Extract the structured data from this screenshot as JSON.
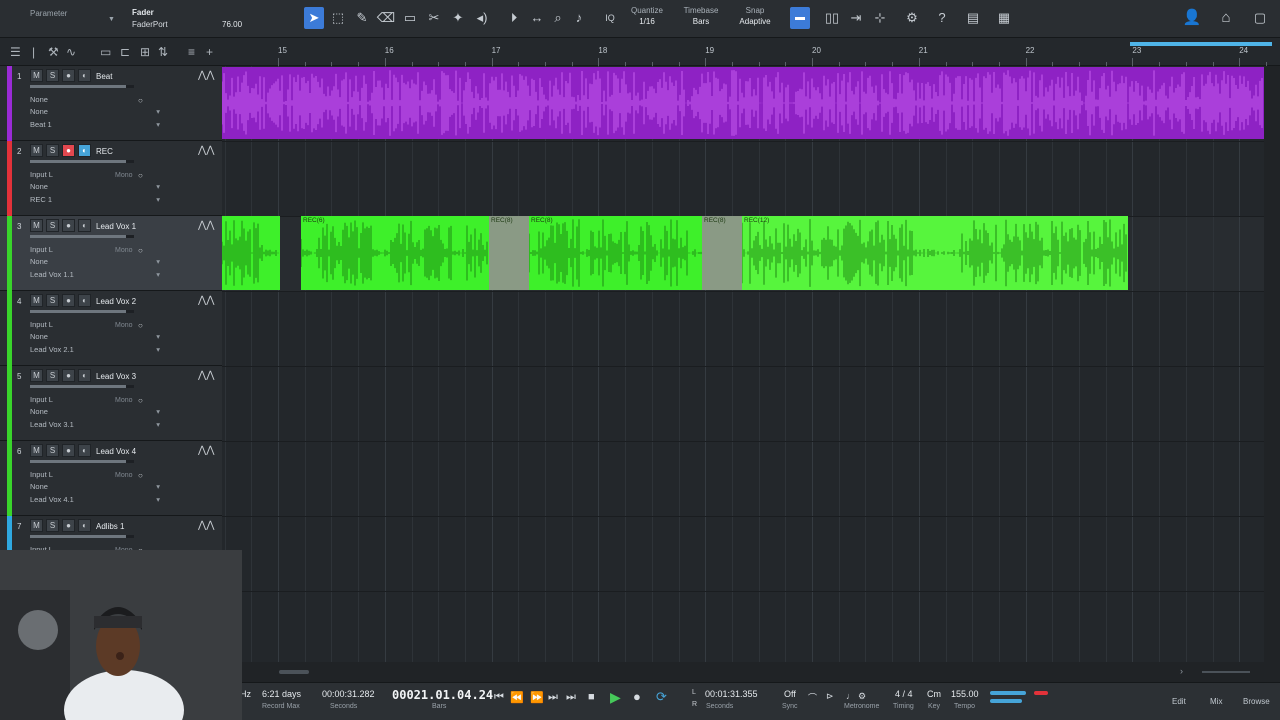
{
  "toolbar": {
    "parameter_label": "Parameter",
    "fader_label": "Fader",
    "fader_source": "FaderPort",
    "fader_value": "76.00",
    "quantize": {
      "label": "Quantize",
      "value": "1/16"
    },
    "timebase": {
      "label": "Timebase",
      "value": "Bars"
    },
    "snap": {
      "label": "Snap",
      "value": "Adaptive"
    },
    "iq_label": "IQ"
  },
  "ruler": {
    "bars": [
      "15",
      "16",
      "17",
      "18",
      "19",
      "20",
      "21",
      "22",
      "23",
      "24"
    ]
  },
  "tracks": [
    {
      "num": "1",
      "name": "Beat",
      "color": "#9a2bd6",
      "input": "None",
      "output": "None",
      "channel": "Beat 1",
      "mono": "",
      "record": false,
      "monitor": false
    },
    {
      "num": "2",
      "name": "REC",
      "color": "#e2323a",
      "input": "Input L",
      "output": "None",
      "channel": "REC 1",
      "mono": "Mono",
      "record": true,
      "monitor": true
    },
    {
      "num": "3",
      "name": "Lead Vox 1",
      "color": "#39d42b",
      "input": "Input L",
      "output": "None",
      "channel": "Lead Vox 1.1",
      "mono": "Mono",
      "record": false,
      "monitor": false
    },
    {
      "num": "4",
      "name": "Lead Vox 2",
      "color": "#39d42b",
      "input": "Input L",
      "output": "None",
      "channel": "Lead Vox 2.1",
      "mono": "Mono",
      "record": false,
      "monitor": false
    },
    {
      "num": "5",
      "name": "Lead Vox 3",
      "color": "#39d42b",
      "input": "Input L",
      "output": "None",
      "channel": "Lead Vox 3.1",
      "mono": "Mono",
      "record": false,
      "monitor": false
    },
    {
      "num": "6",
      "name": "Lead Vox 4",
      "color": "#39d42b",
      "input": "Input L",
      "output": "None",
      "channel": "Lead Vox 4.1",
      "mono": "Mono",
      "record": false,
      "monitor": false
    },
    {
      "num": "7",
      "name": "Adlibs 1",
      "color": "#2fa8e0",
      "input": "Input L",
      "output": "",
      "channel": "",
      "mono": "Mono",
      "record": false,
      "monitor": false
    }
  ],
  "button_labels": {
    "mute": "M",
    "solo": "S"
  },
  "events": {
    "lead_vox_1": [
      "REC(6)",
      "REC(8)",
      "REC(8)",
      "REC(8)",
      "REC(12)"
    ]
  },
  "transport": {
    "sample_rate_unit": "Hz",
    "record_max_value": "6:21 days",
    "record_max_label": "Record Max",
    "seconds_value": "00:00:31.282",
    "seconds_label": "Seconds",
    "bars_position": "00021.01.04.24",
    "bars_label": "Bars",
    "loop_end": "00:01:31.355",
    "loop_end_label": "Seconds",
    "loop_L": "L",
    "loop_R": "R",
    "sync_value": "Off",
    "sync_label": "Sync",
    "metronome_label": "Metronome",
    "timing_value": "4 / 4",
    "timing_label": "Timing",
    "key_value": "Cm",
    "key_label": "Key",
    "tempo_value": "155.00",
    "tempo_label": "Tempo",
    "edit_label": "Edit",
    "mix_label": "Mix",
    "browse_label": "Browse"
  },
  "colors": {
    "beat_event": "#8e22c4",
    "beat_wave": "#c65cf0",
    "vox_event": "#3ef02a",
    "vox_event_sel": "#57f53d",
    "vox_wave": "#1f8a14",
    "accent": "#3c7bd8"
  }
}
